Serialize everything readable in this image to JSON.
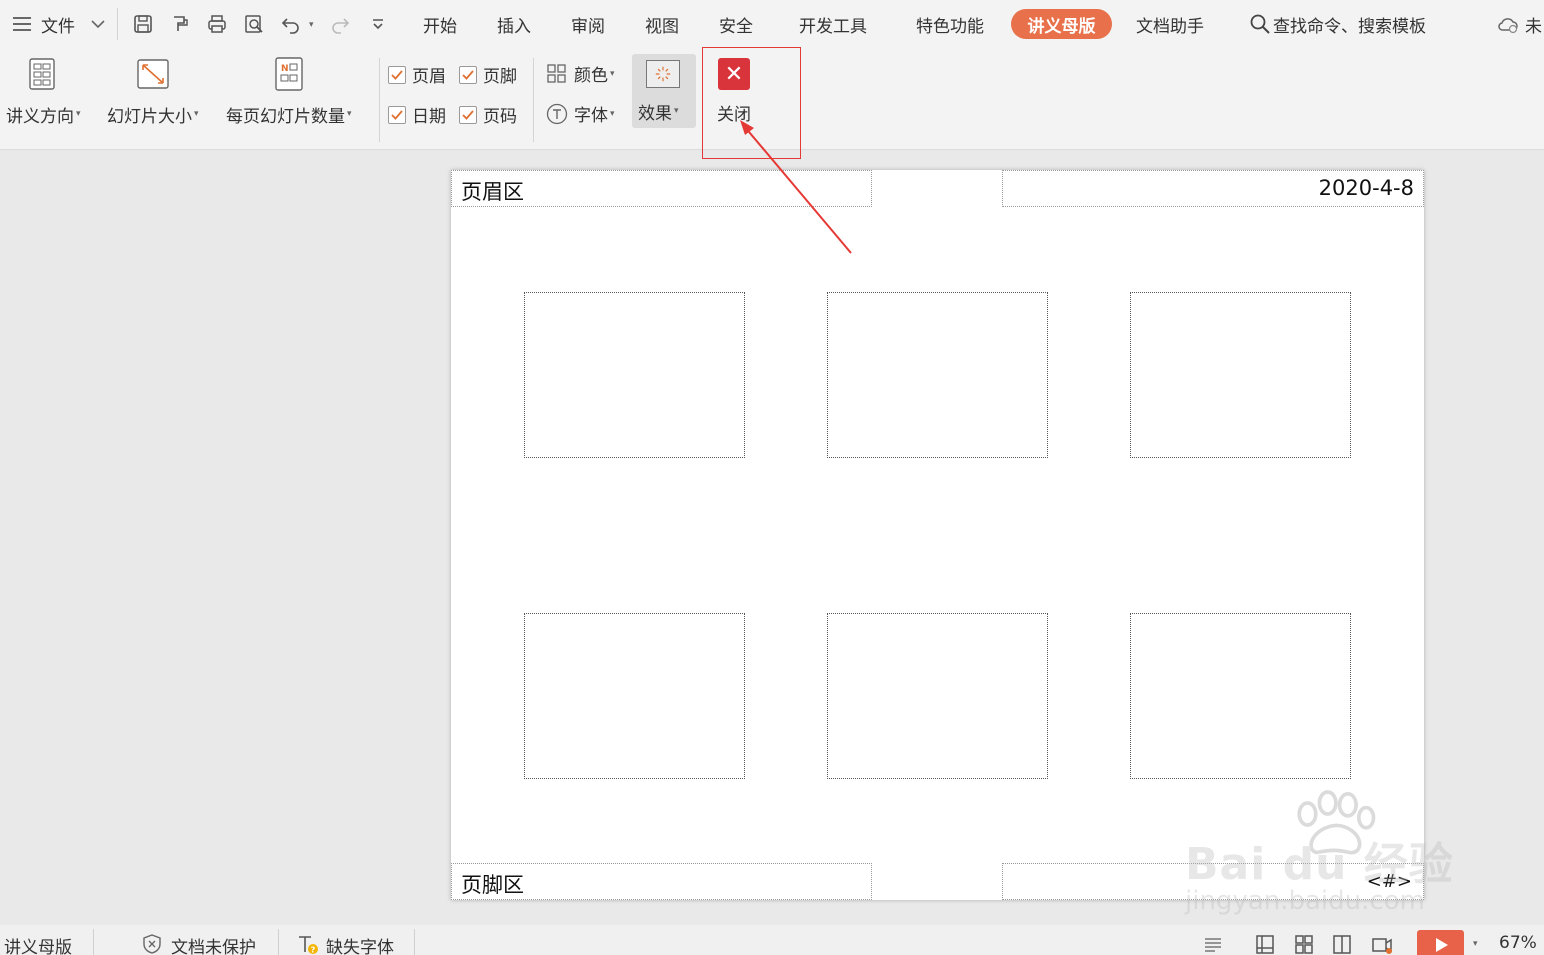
{
  "menubar": {
    "file_label": "文件",
    "tabs": [
      "开始",
      "插入",
      "审阅",
      "视图",
      "安全",
      "开发工具",
      "特色功能",
      "讲义母版",
      "文档助手"
    ],
    "active_tab": "讲义母版",
    "search_placeholder": "查找命令、搜索模板",
    "cloud_label": "未"
  },
  "ribbon": {
    "handout_orientation": "讲义方向",
    "slide_size": "幻灯片大小",
    "slides_per_page": "每页幻灯片数量",
    "checkboxes": [
      {
        "label": "页眉",
        "checked": true
      },
      {
        "label": "页脚",
        "checked": true
      },
      {
        "label": "日期",
        "checked": true
      },
      {
        "label": "页码",
        "checked": true
      }
    ],
    "color_label": "颜色",
    "font_label": "字体",
    "effects_label": "效果",
    "close_label": "关闭"
  },
  "page": {
    "header_text": "页眉区",
    "date_text": "2020-4-8",
    "footer_text": "页脚区",
    "page_number_text": "<#>",
    "slot_count": 6
  },
  "statusbar": {
    "mode_label": "讲义母版",
    "protect_label": "文档未保护",
    "font_missing_label": "缺失字体",
    "zoom": "67%"
  },
  "watermark": {
    "brand": "Bai du 经验",
    "url": "jingyan.baidu.com"
  },
  "colors": {
    "active_tab": "#e8704a",
    "close_button": "#d9343b",
    "highlight": "#e53935",
    "play_button": "#e8624a"
  }
}
